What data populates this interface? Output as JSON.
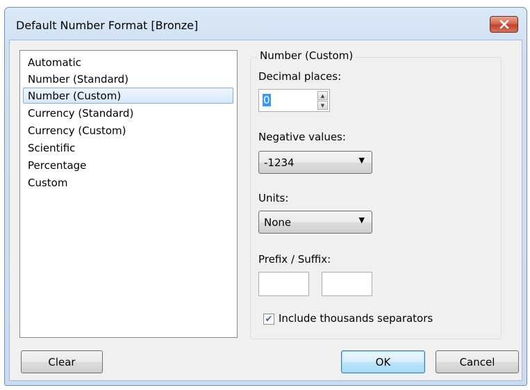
{
  "window": {
    "title": "Default Number Format [Bronze]",
    "close_icon": "close-x-icon"
  },
  "format_list": {
    "items": [
      "Automatic",
      "Number (Standard)",
      "Number (Custom)",
      "Currency (Standard)",
      "Currency (Custom)",
      "Scientific",
      "Percentage",
      "Custom"
    ],
    "selected": "Number (Custom)"
  },
  "group": {
    "title": "Number (Custom)"
  },
  "decimal_places": {
    "label": "Decimal places:",
    "value": "0"
  },
  "negative_values": {
    "label": "Negative values:",
    "selected": "-1234"
  },
  "units": {
    "label": "Units:",
    "selected": "None"
  },
  "prefix_suffix": {
    "label": "Prefix / Suffix:",
    "prefix": "",
    "suffix": ""
  },
  "thousands": {
    "label": "Include thousands separators",
    "checked": true
  },
  "buttons": {
    "clear": "Clear",
    "ok": "OK",
    "cancel": "Cancel"
  }
}
